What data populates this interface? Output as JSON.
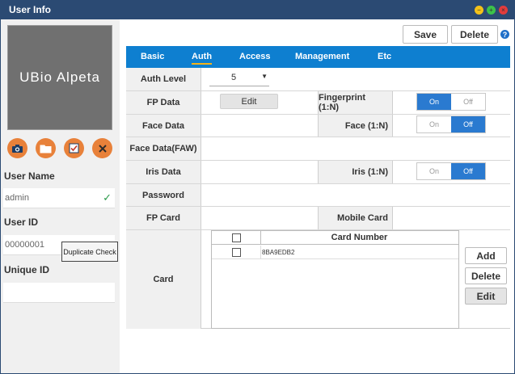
{
  "window": {
    "title": "User Info"
  },
  "photo": {
    "placeholder": "UBio Alpeta"
  },
  "left": {
    "user_name_label": "User Name",
    "user_name_value": "admin",
    "user_id_label": "User ID",
    "user_id_value": "00000001",
    "unique_id_label": "Unique ID",
    "duplicate_check_label": "Duplicate Check",
    "unique_id_value": ""
  },
  "toolbar": {
    "save_label": "Save",
    "delete_label": "Delete",
    "help_glyph": "?"
  },
  "tabs": [
    {
      "label": "Basic",
      "active": false
    },
    {
      "label": "Auth",
      "active": true
    },
    {
      "label": "Access",
      "active": false
    },
    {
      "label": "Management",
      "active": false
    },
    {
      "label": "Etc",
      "active": false
    }
  ],
  "auth": {
    "auth_level_label": "Auth Level",
    "auth_level_value": "5",
    "fp_data_label": "FP Data",
    "fp_edit_label": "Edit",
    "fingerprint_label": "Fingerprint (1:N)",
    "fingerprint_toggle": "on",
    "face_data_label": "Face Data",
    "face_label": "Face (1:N)",
    "face_toggle": "off",
    "face_data_faw_label": "Face Data(FAW)",
    "iris_data_label": "Iris Data",
    "iris_label": "Iris (1:N)",
    "iris_toggle": "off",
    "password_label": "Password",
    "fp_card_label": "FP Card",
    "mobile_card_label": "Mobile Card",
    "card_label": "Card",
    "toggle_on": "On",
    "toggle_off": "Off"
  },
  "card_table": {
    "header": "Card Number",
    "rows": [
      "8BA9EDB2"
    ],
    "add_label": "Add",
    "delete_label": "Delete",
    "edit_label": "Edit"
  },
  "colors": {
    "accent": "#0e7fd0",
    "title_bar": "#2b4a73",
    "toggle_on": "#2a7ad0",
    "icon_orange": "#e8813a",
    "tab_underline": "#f3b21a"
  }
}
